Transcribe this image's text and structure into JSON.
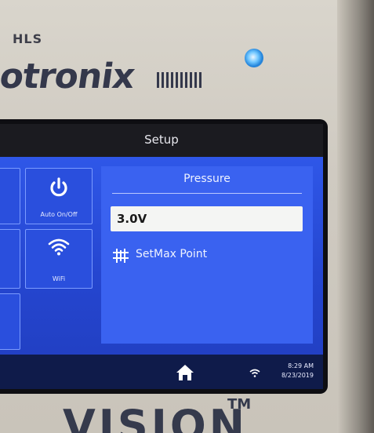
{
  "device": {
    "brand_top": "HLS",
    "brand_main": "otronix",
    "brand_bottom": "VISION",
    "brand_bottom_mark": "TM"
  },
  "screen": {
    "title": "Setup",
    "tiles": [
      {
        "label": "Auto On/Off",
        "icon": "power-icon"
      },
      {
        "label": "WiFi",
        "icon": "wifi-icon"
      }
    ],
    "panel": {
      "title": "Pressure",
      "value": "3.0V",
      "setmax_label": "SetMax Point",
      "setmax_icon": "sliders-icon"
    },
    "status": {
      "home_icon": "home-icon",
      "wifi_icon": "wifi-icon",
      "time": "8:29 AM",
      "date": "8/23/2019"
    }
  },
  "colors": {
    "screen_blue": "#2f57e8",
    "panel_blue": "#3a62f0",
    "status_bar": "#0f1b4a",
    "led_blue": "#6fc6ff"
  }
}
